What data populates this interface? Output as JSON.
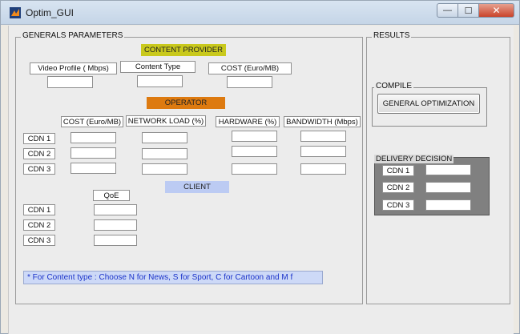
{
  "window": {
    "title": "Optim_GUI",
    "close_glyph": "✕",
    "min_glyph": "—",
    "max_glyph": "☐"
  },
  "generals": {
    "title": "GENERALS PARAMETERS",
    "content_provider": {
      "header": "CONTENT PROVIDER",
      "video_profile_label": "Video Profile ( Mbps)",
      "content_type_label": "Content Type",
      "cost_label": "COST (Euro/MB)",
      "video_profile_value": "",
      "content_type_value": "",
      "cost_value": ""
    },
    "operator": {
      "header": "OPERATOR",
      "columns": [
        "COST (Euro/MB)",
        "NETWORK LOAD (%)",
        "HARDWARE  (%)",
        "BANDWIDTH (Mbps)"
      ],
      "rows": [
        {
          "label": "CDN 1",
          "values": [
            "",
            "",
            "",
            ""
          ]
        },
        {
          "label": "CDN 2",
          "values": [
            "",
            "",
            "",
            ""
          ]
        },
        {
          "label": "CDN 3",
          "values": [
            "",
            "",
            "",
            ""
          ]
        }
      ]
    },
    "client": {
      "header": "CLIENT",
      "column": "QoE",
      "rows": [
        {
          "label": "CDN 1",
          "value": ""
        },
        {
          "label": "CDN 2",
          "value": ""
        },
        {
          "label": "CDN 3",
          "value": ""
        }
      ]
    },
    "note": "* For Content type : Choose N for News, S for Sport, C for Cartoon and M f"
  },
  "results": {
    "title": "RESULTS",
    "compile": {
      "title": "COMPILE",
      "button_label": "GENERAL OPTIMIZATION"
    },
    "delivery": {
      "title": "DELIVERY DECISION",
      "rows": [
        {
          "label": "CDN 1",
          "value": ""
        },
        {
          "label": "CDN 2",
          "value": ""
        },
        {
          "label": "CDN 3",
          "value": ""
        }
      ]
    }
  },
  "colors": {
    "content_provider_header": "#c9c91c",
    "operator_header": "#dd7a10",
    "client_header": "#bccbf3",
    "note_text": "#1b33c9",
    "delivery_panel": "#808080"
  }
}
